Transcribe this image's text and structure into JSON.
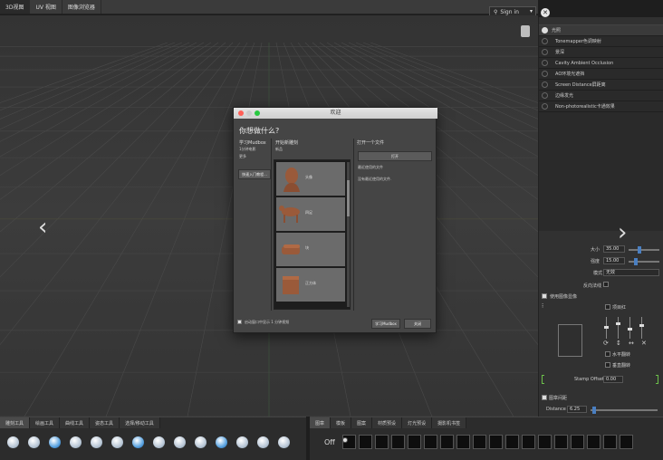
{
  "top_tabs": [
    "3D视图",
    "UV 视图",
    "图像浏览器"
  ],
  "sign_in": "Sign in",
  "close_glyph": "✕",
  "right_panel": {
    "list": [
      "光照",
      "Tonemapper色调映射",
      "景深",
      "Cavity Ambient Occlusion",
      "AO环境光遮挡",
      "Screen Distance屏距离",
      "边缘发光",
      "Non-photorealistic卡通效果"
    ],
    "size_label": "大小",
    "size_value": "35.00",
    "strength_label": "强度",
    "strength_value": "15.00",
    "mode_label": "模式",
    "mode_value": "无效",
    "reflect_label": "反向法线",
    "use_image_label": "使用图像显像",
    "project_label": "项目红",
    "flip_h_label": "水平翻转",
    "flip_v_label": "垂直翻转",
    "stamp_offset_label": "Stamp Offset",
    "stamp_offset_value": "0.00",
    "stamp_spacing_label": "图章间距",
    "distance_label": "Distance",
    "distance_value": "6.25"
  },
  "bottom_left_tabs": [
    "雕刻工具",
    "绘画工具",
    "曲线工具",
    "姿态工具",
    "选择/移动工具"
  ],
  "bottom_right_tabs": [
    "图章",
    "模板",
    "图案",
    "材质预设",
    "灯光预设",
    "摄影机书签"
  ],
  "off_label": "Off",
  "dialog": {
    "title": "欢迎",
    "heading": "你想做什么?",
    "learn_title": "学习Mudbox",
    "learn_sub": "1分钟电影",
    "learn_more": "更多",
    "learn_button": "快速入门教程...",
    "new_title": "开始新雕刻",
    "new_sub": "新品",
    "scenes": [
      "头像",
      "四足",
      "块",
      "正方体"
    ],
    "open_title": "打开一个文件",
    "open_button": "打开",
    "recent_title": "最近使用的文件",
    "recent_none": "没有最近使用的文件.",
    "show_checkbox_label": "启动窗口中显示 1 分钟视频",
    "learn_mudbox_button": "学习Mudbox",
    "close_button": "关闭"
  }
}
